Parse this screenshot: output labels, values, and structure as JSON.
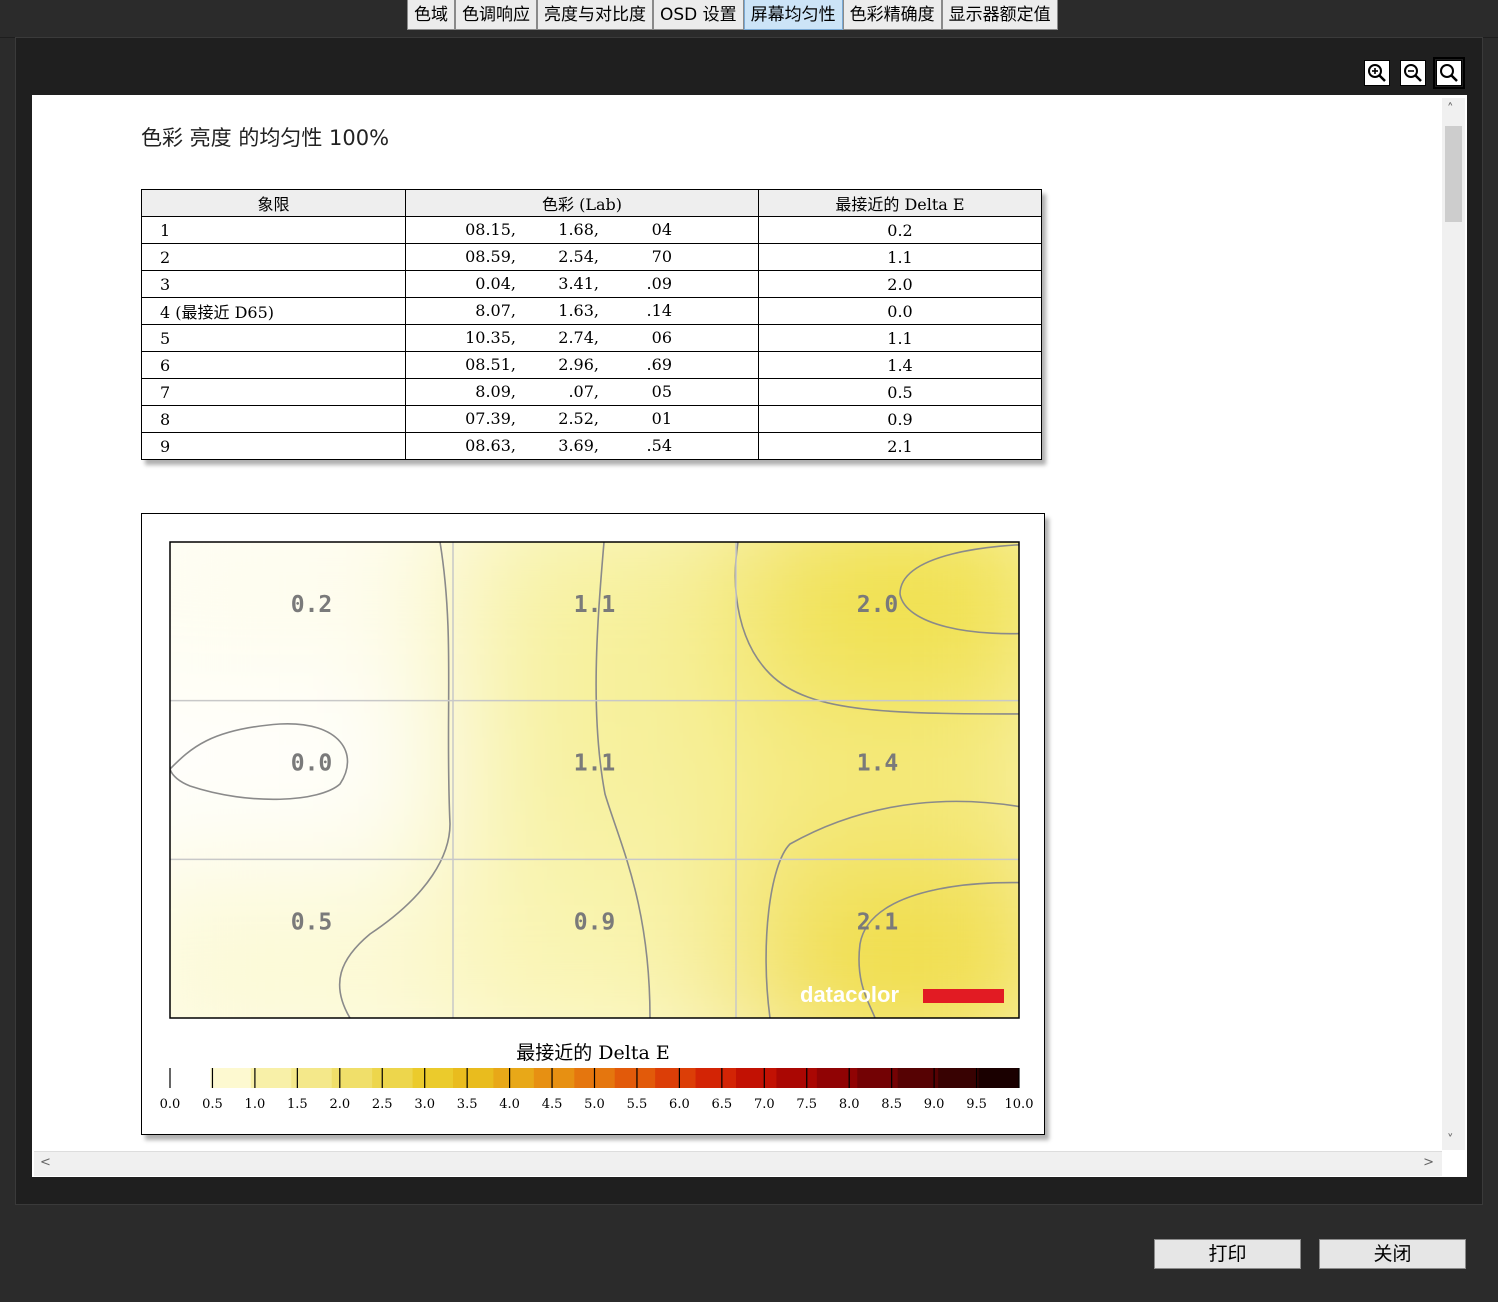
{
  "tabs": [
    {
      "label": "色域",
      "active": false
    },
    {
      "label": "色调响应",
      "active": false
    },
    {
      "label": "亮度与对比度",
      "active": false
    },
    {
      "label": "OSD 设置",
      "active": false
    },
    {
      "label": "屏幕均匀性",
      "active": true
    },
    {
      "label": "色彩精确度",
      "active": false
    },
    {
      "label": "显示器额定值",
      "active": false
    }
  ],
  "toolbar": {
    "zoom_in_icon": "zoom-in-icon",
    "zoom_out_icon": "zoom-out-icon",
    "zoom_fit_icon": "zoom-fit-icon"
  },
  "report": {
    "title": "色彩 亮度 的均匀性 100%",
    "table": {
      "headers": [
        "象限",
        "色彩 (Lab)",
        "最接近的 Delta E"
      ],
      "rows": [
        {
          "quadrant": "1",
          "l": "08.15,",
          "a": "1.68,",
          "b": "04",
          "delta_e": "0.2"
        },
        {
          "quadrant": "2",
          "l": "08.59,",
          "a": "2.54,",
          "b": "70",
          "delta_e": "1.1"
        },
        {
          "quadrant": "3",
          "l": "0.04,",
          "a": "3.41,",
          "b": ".09",
          "delta_e": "2.0"
        },
        {
          "quadrant": "4 (最接近 D65)",
          "l": "8.07,",
          "a": "1.63,",
          "b": ".14",
          "delta_e": "0.0"
        },
        {
          "quadrant": "5",
          "l": "10.35,",
          "a": "2.74,",
          "b": "06",
          "delta_e": "1.1"
        },
        {
          "quadrant": "6",
          "l": "08.51,",
          "a": "2.96,",
          "b": ".69",
          "delta_e": "1.4"
        },
        {
          "quadrant": "7",
          "l": "8.09,",
          "a": ".07,",
          "b": "05",
          "delta_e": "0.5"
        },
        {
          "quadrant": "8",
          "l": "07.39,",
          "a": "2.52,",
          "b": "01",
          "delta_e": "0.9"
        },
        {
          "quadrant": "9",
          "l": "08.63,",
          "a": "3.69,",
          "b": ".54",
          "delta_e": "2.1"
        }
      ]
    },
    "logo": "datacolor"
  },
  "chart_data": {
    "type": "heatmap",
    "grid": {
      "rows": 3,
      "cols": 3
    },
    "values": [
      [
        0.2,
        1.1,
        2.0
      ],
      [
        0.0,
        1.1,
        1.4
      ],
      [
        0.5,
        0.9,
        2.1
      ]
    ],
    "labels": [
      [
        "0.2",
        "1.1",
        "2.0"
      ],
      [
        "0.0",
        "1.1",
        "1.4"
      ],
      [
        "0.5",
        "0.9",
        "2.1"
      ]
    ],
    "legend_title": "最接近的 Delta E",
    "scale_ticks": [
      "0.0",
      "0.5",
      "1.0",
      "1.5",
      "2.0",
      "2.5",
      "3.0",
      "3.5",
      "4.0",
      "4.5",
      "5.0",
      "5.5",
      "6.0",
      "6.5",
      "7.0",
      "7.5",
      "8.0",
      "8.5",
      "9.0",
      "9.5",
      "10.0"
    ],
    "scale_colors": [
      "#ffffff",
      "#fdf9d0",
      "#f8f0a8",
      "#f4e88a",
      "#f0df6a",
      "#edd64c",
      "#ebcb2c",
      "#e9bc1e",
      "#e8a818",
      "#e79012",
      "#e5760e",
      "#e25a0a",
      "#dc3e07",
      "#d32405",
      "#c21103",
      "#aa0703",
      "#900304",
      "#730204",
      "#560203",
      "#380202",
      "#1a0000"
    ]
  },
  "buttons": {
    "print": "打印",
    "close": "关闭"
  }
}
